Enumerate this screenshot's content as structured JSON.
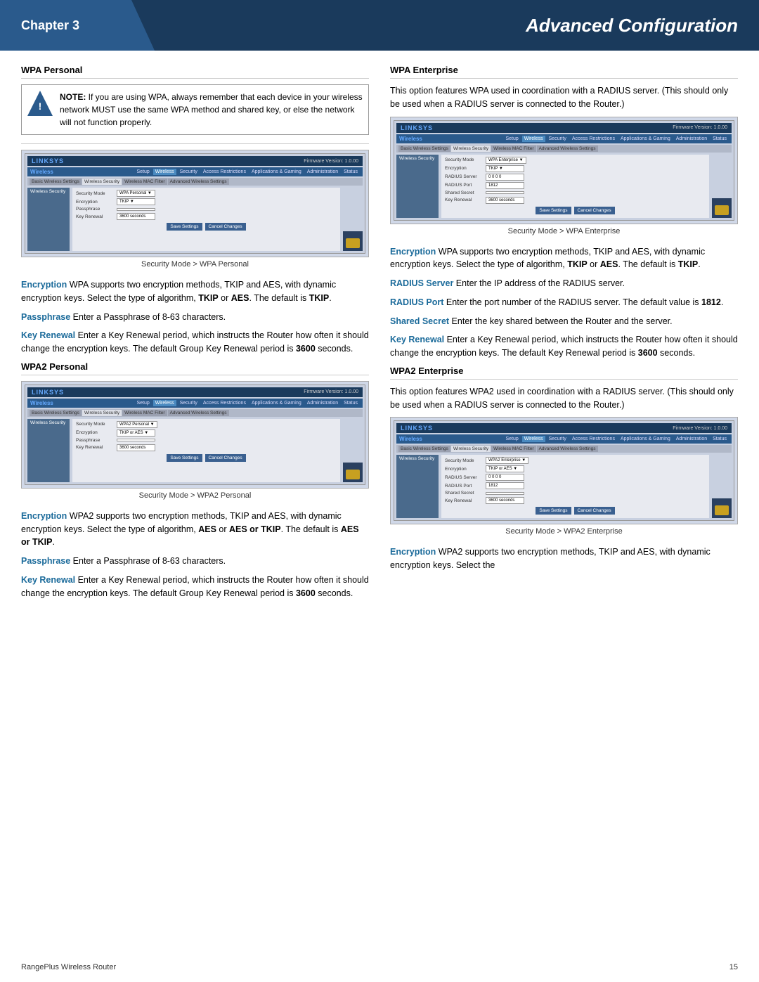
{
  "header": {
    "chapter_label": "Chapter 3",
    "title": "Advanced Configuration"
  },
  "footer": {
    "left": "RangePlus Wireless Router",
    "right": "15"
  },
  "left_col": {
    "wpa_personal": {
      "heading": "WPA Personal",
      "note": {
        "bold": "NOTE:",
        "text": " If you are using WPA, always remember that each device in your wireless network MUST use the same WPA method and shared key, or else the network will not function properly."
      },
      "screenshot_caption": "Security Mode > WPA Personal",
      "screenshot": {
        "logo": "LINKSYS",
        "section": "Wireless",
        "nav_items": [
          "Setup",
          "Wireless",
          "Security",
          "Access Restrictions",
          "Applications & Gaming",
          "Administration",
          "Status"
        ],
        "tabs": [
          "Basic Wireless Settings",
          "Wireless Security",
          "Wireless MAC Filter",
          "Advanced Wireless Settings"
        ],
        "sidebar_label": "Wireless Security",
        "fields": [
          {
            "label": "Security Mode",
            "value": "WPA Personal"
          },
          {
            "label": "Encryption",
            "value": "TKIP"
          },
          {
            "label": "Passphrase",
            "value": ""
          },
          {
            "label": "Key Renewal",
            "value": "3600   seconds"
          }
        ],
        "buttons": [
          "Save Settings",
          "Cancel Changes"
        ]
      },
      "paragraphs": [
        {
          "term": "Encryption",
          "text": "  WPA supports two encryption methods, TKIP and AES, with dynamic encryption keys. Select the type of algorithm, TKIP or AES. The default is TKIP."
        },
        {
          "term": "Passphrase",
          "text": "  Enter a Passphrase of 8-63 characters."
        },
        {
          "term": "Key Renewal",
          "text": "  Enter a Key Renewal period, which instructs the Router how often it should change the encryption keys. The default Group Key Renewal period is 3600 seconds."
        }
      ]
    },
    "wpa2_personal": {
      "heading": "WPA2 Personal",
      "screenshot_caption": "Security Mode > WPA2 Personal",
      "screenshot": {
        "logo": "LINKSYS",
        "section": "Wireless",
        "nav_items": [
          "Setup",
          "Wireless",
          "Security",
          "Access Restrictions",
          "Applications & Gaming",
          "Administration",
          "Status"
        ],
        "tabs": [
          "Basic Wireless Settings",
          "Wireless Security",
          "Wireless MAC Filter",
          "Advanced Wireless Settings"
        ],
        "sidebar_label": "Wireless Security",
        "fields": [
          {
            "label": "Security Mode",
            "value": "WPA2 Personal"
          },
          {
            "label": "Encryption",
            "value": "TKIP or AES"
          },
          {
            "label": "Passphrase",
            "value": ""
          },
          {
            "label": "Key Renewal",
            "value": "3600   seconds"
          }
        ],
        "buttons": [
          "Save Settings",
          "Cancel Changes"
        ]
      },
      "paragraphs": [
        {
          "term": "Encryption",
          "text": "  WPA2 supports two encryption methods, TKIP and AES, with dynamic encryption keys. Select the type of algorithm, AES or AES or TKIP. The default is AES or TKIP."
        },
        {
          "term": "Passphrase",
          "text": "  Enter a Passphrase of 8-63 characters."
        },
        {
          "term": "Key Renewal",
          "text": "  Enter a Key Renewal period, which instructs the Router how often it should change the encryption keys. The default Group Key Renewal period is 3600 seconds."
        }
      ]
    }
  },
  "right_col": {
    "wpa_enterprise": {
      "heading": "WPA Enterprise",
      "intro": "This option features WPA used in coordination with a RADIUS server. (This should only be used when a RADIUS server is connected to the Router.)",
      "screenshot_caption": "Security Mode > WPA Enterprise",
      "screenshot": {
        "logo": "LINKSYS",
        "section": "Wireless",
        "nav_items": [
          "Setup",
          "Wireless",
          "Security",
          "Access Restrictions",
          "Applications & Gaming",
          "Administration",
          "Status"
        ],
        "tabs": [
          "Basic Wireless Settings",
          "Wireless Security",
          "Wireless MAC Filter",
          "Advanced Wireless Settings"
        ],
        "sidebar_label": "Wireless Security",
        "fields": [
          {
            "label": "Security Mode",
            "value": "WPA Enterprise"
          },
          {
            "label": "Encryption",
            "value": "TKIP"
          },
          {
            "label": "RADIUS Server",
            "value": "0   0   0   0"
          },
          {
            "label": "RADIUS Port",
            "value": "1812"
          },
          {
            "label": "Shared Secret",
            "value": ""
          },
          {
            "label": "Key Renewal",
            "value": "3600   seconds"
          }
        ],
        "buttons": [
          "Save Settings",
          "Cancel Changes"
        ]
      },
      "paragraphs": [
        {
          "term": "Encryption",
          "text": "  WPA supports two encryption methods, TKIP and AES, with dynamic encryption keys. Select the type of algorithm, TKIP or AES. The default is TKIP."
        },
        {
          "term": "RADIUS Server",
          "text": "  Enter the IP address of the RADIUS server."
        },
        {
          "term": "RADIUS Port",
          "text": "   Enter the port number of the RADIUS server. The default value is 1812."
        },
        {
          "term": "Shared Secret",
          "text": "  Enter the key shared between the Router and the server."
        },
        {
          "term": "Key Renewal",
          "text": "  Enter a Key Renewal period, which instructs the Router how often it should change the encryption keys. The default Key Renewal period is 3600 seconds."
        }
      ]
    },
    "wpa2_enterprise": {
      "heading": "WPA2 Enterprise",
      "intro": "This option features WPA2 used in coordination with a RADIUS server. (This should only be used when a RADIUS server is connected to the Router.)",
      "screenshot_caption": "Security Mode > WPA2 Enterprise",
      "screenshot": {
        "logo": "LINKSYS",
        "section": "Wireless",
        "nav_items": [
          "Setup",
          "Wireless",
          "Security",
          "Access Restrictions",
          "Applications & Gaming",
          "Administration",
          "Status"
        ],
        "tabs": [
          "Basic Wireless Settings",
          "Wireless Security",
          "Wireless MAC Filter",
          "Advanced Wireless Settings"
        ],
        "sidebar_label": "Wireless Security",
        "fields": [
          {
            "label": "Security Mode",
            "value": "WPA2 Enterprise"
          },
          {
            "label": "Encryption",
            "value": "TKIP or AES"
          },
          {
            "label": "RADIUS Server",
            "value": "0   0   0   0"
          },
          {
            "label": "RADIUS Port",
            "value": "1812"
          },
          {
            "label": "Shared Secret",
            "value": ""
          },
          {
            "label": "Key Renewal",
            "value": "3600   seconds"
          }
        ],
        "buttons": [
          "Save Settings",
          "Cancel Changes"
        ]
      },
      "paragraphs": [
        {
          "term": "Encryption",
          "text": "  WPA2 supports two encryption methods, TKIP and AES, with dynamic encryption keys. Select the"
        }
      ]
    }
  }
}
